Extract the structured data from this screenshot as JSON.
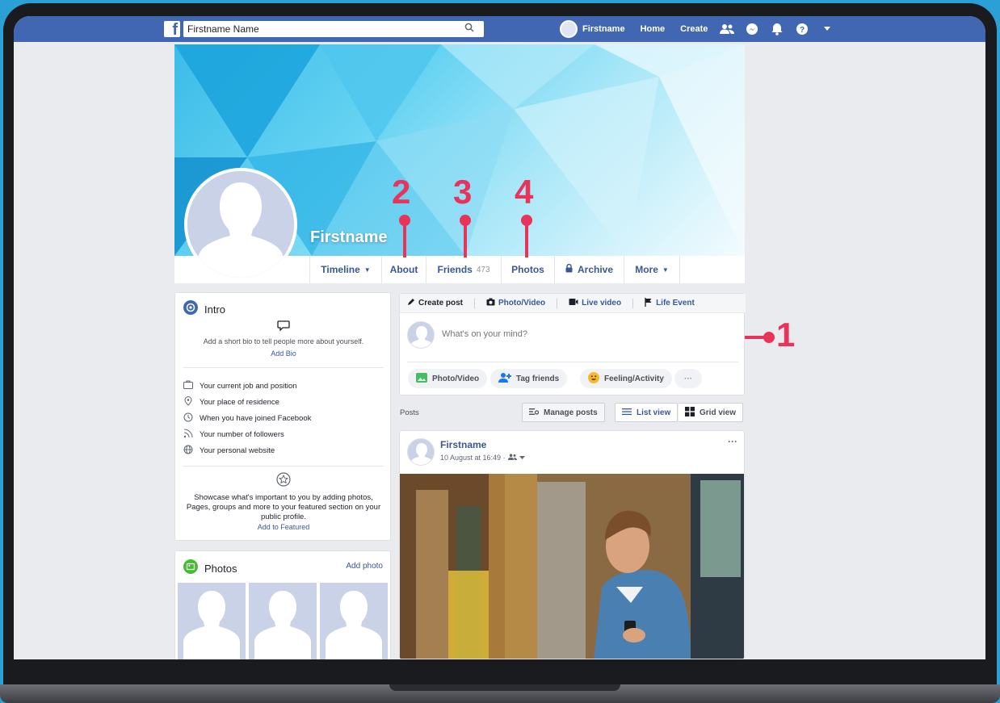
{
  "topbar": {
    "search_value": "Firstname Name",
    "profile_name": "Firstname",
    "home_label": "Home",
    "create_label": "Create"
  },
  "profile": {
    "cover_name": "Firstname",
    "tabs": [
      {
        "label": "Timeline",
        "caret": "▼"
      },
      {
        "label": "About"
      },
      {
        "label": "Friends",
        "count": "473"
      },
      {
        "label": "Photos"
      },
      {
        "label": "Archive"
      },
      {
        "label": "More",
        "caret": "▼"
      }
    ]
  },
  "markers": [
    "1",
    "2",
    "3",
    "4"
  ],
  "intro": {
    "title": "Intro",
    "bio_prompt": "Add a short bio to tell people more about yourself.",
    "add_bio": "Add Bio",
    "rows": [
      "Your current job and position",
      "Your place of residence",
      "When you have joined Facebook",
      "Your number of followers",
      "Your personal website"
    ],
    "featured_text": "Showcase what's important to you by adding photos, Pages, groups and more to your featured section on your public profile.",
    "add_featured": "Add to Featured"
  },
  "photos_card": {
    "title": "Photos",
    "add_photo": "Add photo"
  },
  "composer": {
    "tabs": [
      "Create post",
      "Photo/Video",
      "Live video",
      "Life Event"
    ],
    "placeholder": "What's on your mind?",
    "chips": [
      "Photo/Video",
      "Tag friends",
      "Feeling/Activity",
      "···"
    ]
  },
  "posts_bar": {
    "label": "Posts",
    "manage": "Manage posts",
    "list_view": "List view",
    "grid_view": "Grid view"
  },
  "post": {
    "author": "Firstname",
    "timestamp": "10 August at 16:49 · ",
    "more": "···"
  },
  "colors": {
    "brand": "#4267b2",
    "link": "#385898",
    "marker": "#e8335a",
    "outer_bg": "#2aa0d6"
  }
}
